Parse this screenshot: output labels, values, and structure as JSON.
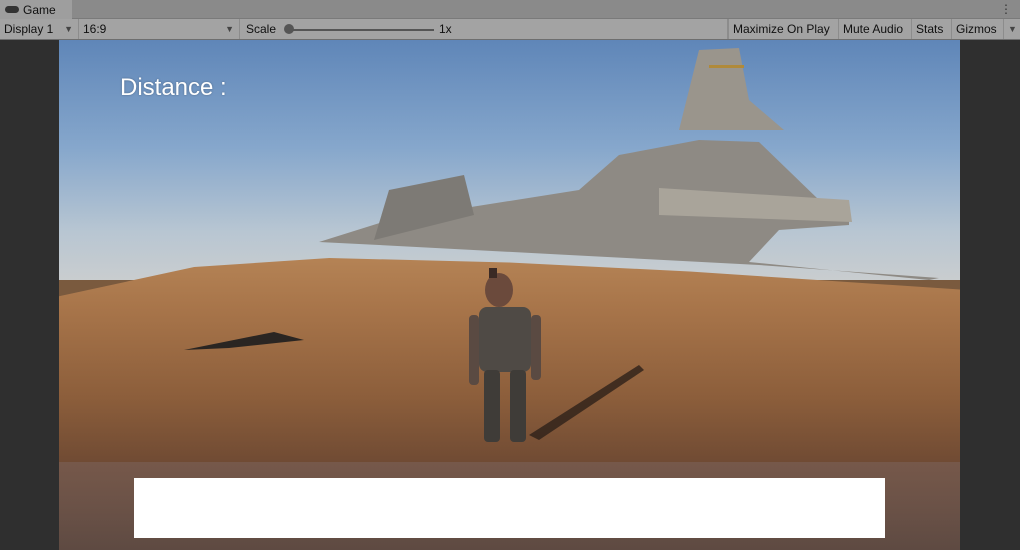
{
  "window": {
    "tab_label": "Game",
    "tab_icon": "gamepad-icon"
  },
  "toolbar": {
    "display": "Display 1",
    "aspect": "16:9",
    "scale_label": "Scale",
    "scale_value": "1x",
    "scale_fraction": 0,
    "maximize": "Maximize On Play",
    "mute": "Mute Audio",
    "stats": "Stats",
    "gizmos": "Gizmos"
  },
  "game": {
    "distance_label": "Distance :"
  }
}
